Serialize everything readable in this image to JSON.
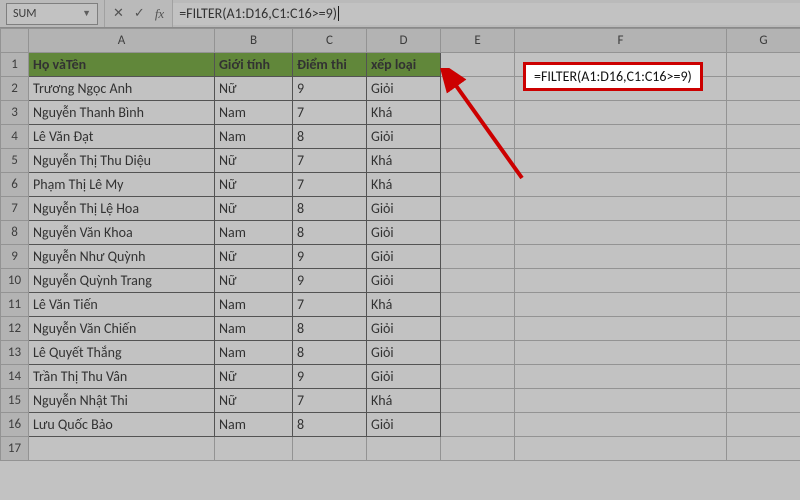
{
  "formula_bar": {
    "name_box": "SUM",
    "cancel_icon": "✕",
    "confirm_icon": "✓",
    "fx_label": "fx",
    "formula": "=FILTER(A1:D16,C1:C16>=9)"
  },
  "columns": [
    "A",
    "B",
    "C",
    "D",
    "E",
    "F",
    "G"
  ],
  "header_row": {
    "a": "Họ vàTên",
    "b": "Giới tính",
    "c": "Điểm thi",
    "d": "xếp loại"
  },
  "rows": [
    {
      "n": 1
    },
    {
      "n": 2,
      "a": "Trương Ngọc Anh",
      "b": "Nữ",
      "c": 9,
      "d": "Giỏi"
    },
    {
      "n": 3,
      "a": "Nguyễn Thanh Bình",
      "b": "Nam",
      "c": 7,
      "d": "Khá"
    },
    {
      "n": 4,
      "a": "Lê Văn Đạt",
      "b": "Nam",
      "c": 8,
      "d": "Giỏi"
    },
    {
      "n": 5,
      "a": "Nguyễn Thị Thu Diệu",
      "b": "Nữ",
      "c": 7,
      "d": "Khá"
    },
    {
      "n": 6,
      "a": "Phạm Thị Lê My",
      "b": "Nữ",
      "c": 7,
      "d": "Khá"
    },
    {
      "n": 7,
      "a": "Nguyễn Thị Lệ Hoa",
      "b": "Nữ",
      "c": 8,
      "d": "Giỏi"
    },
    {
      "n": 8,
      "a": "Nguyễn Văn Khoa",
      "b": "Nam",
      "c": 8,
      "d": "Giỏi"
    },
    {
      "n": 9,
      "a": "Nguyễn Như Quỳnh",
      "b": "Nữ",
      "c": 9,
      "d": "Giỏi"
    },
    {
      "n": 10,
      "a": "Nguyễn Quỳnh Trang",
      "b": "Nữ",
      "c": 9,
      "d": "Giỏi"
    },
    {
      "n": 11,
      "a": "Lê Văn Tiến",
      "b": "Nam",
      "c": 7,
      "d": "Khá"
    },
    {
      "n": 12,
      "a": "Nguyễn Văn Chiến",
      "b": "Nam",
      "c": 8,
      "d": "Giỏi"
    },
    {
      "n": 13,
      "a": "Lê Quyết Thắng",
      "b": "Nam",
      "c": 8,
      "d": "Giỏi"
    },
    {
      "n": 14,
      "a": "Trần Thị Thu Vân",
      "b": "Nữ",
      "c": 9,
      "d": "Giỏi"
    },
    {
      "n": 15,
      "a": "Nguyễn Nhật Thi",
      "b": "Nữ",
      "c": 7,
      "d": "Khá"
    },
    {
      "n": 16,
      "a": "Lưu Quốc Bảo",
      "b": "Nam",
      "c": 8,
      "d": "Giỏi"
    },
    {
      "n": 17
    }
  ],
  "annotation": {
    "text": "=FILTER(A1:D16,C1:C16>=9)"
  }
}
